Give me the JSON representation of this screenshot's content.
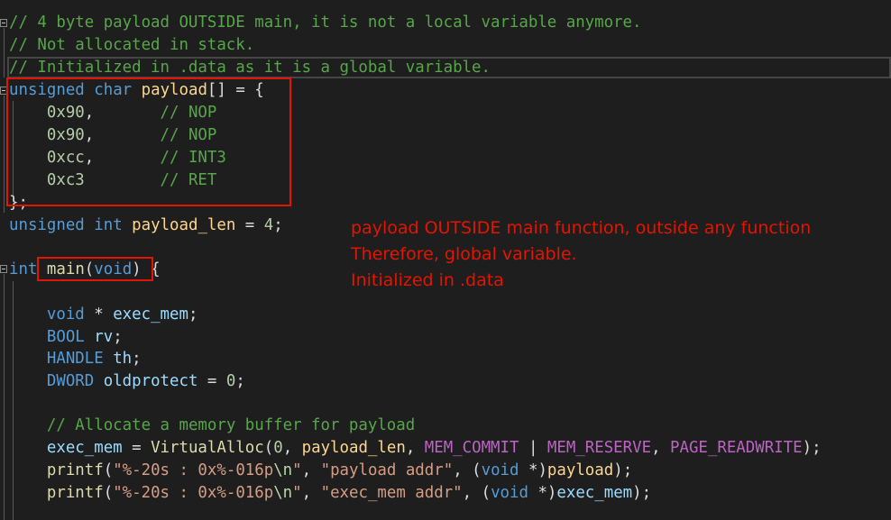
{
  "code": {
    "comment_1": "// 4 byte payload OUTSIDE main, it is not a local variable anymore.",
    "comment_2": "// Not allocated in stack.",
    "comment_3": "// Initialized in .data as it is a global variable.",
    "kw_unsigned": "unsigned",
    "kw_char": "char",
    "kw_int": "int",
    "kw_void": "void",
    "type_bool": "BOOL",
    "type_handle": "HANDLE",
    "type_dword": "DWORD",
    "var_payload": "payload",
    "var_payload_len": "payload_len",
    "var_exec_mem": "exec_mem",
    "var_rv": "rv",
    "var_th": "th",
    "var_oldprotect": "oldprotect",
    "fn_main": "main",
    "fn_virtualalloc": "VirtualAlloc",
    "fn_printf": "printf",
    "num_0x90": "0x90",
    "num_0xcc": "0xcc",
    "num_0xc3": "0xc3",
    "num_4": "4",
    "num_0": "0",
    "cmt_nop": "// NOP",
    "cmt_int3": "// INT3",
    "cmt_ret": "// RET",
    "comment_alloc": "// Allocate a memory buffer for payload",
    "macro_commit": "MEM_COMMIT",
    "macro_reserve": "MEM_RESERVE",
    "macro_readwrite": "PAGE_READWRITE",
    "fmt_part1": "\"%-20s : 0x%-016p",
    "fmt_escape": "\\n",
    "fmt_part2": "\"",
    "str_payload_addr": "\"payload addr\"",
    "str_exec_mem_addr": "\"exec_mem addr\""
  },
  "annotation": {
    "line1": "payload OUTSIDE main function, outside any function",
    "line2": "Therefore, global variable.",
    "line3": "Initialized in .data"
  }
}
